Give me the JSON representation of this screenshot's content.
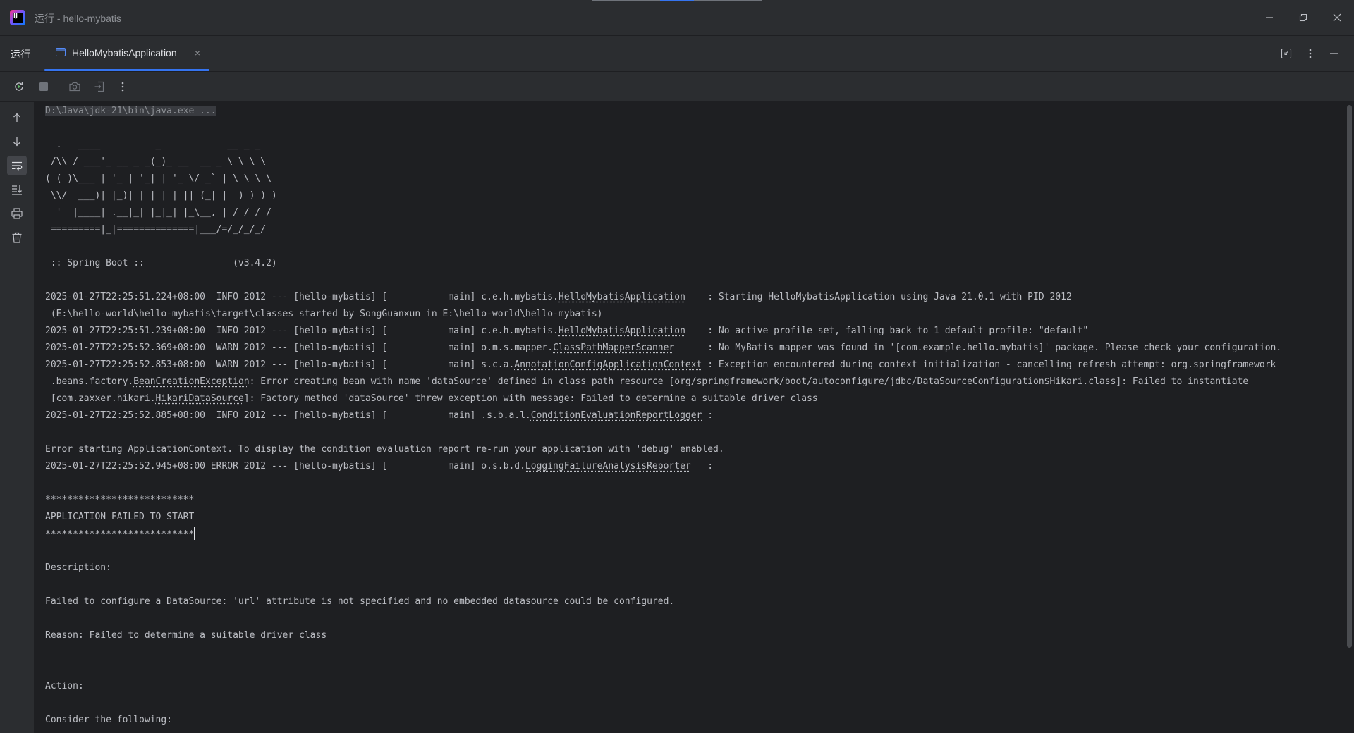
{
  "window": {
    "title": "运行 - hello-mybatis",
    "logo_text": "IJ",
    "icons": [
      "minimize-icon",
      "restore-icon",
      "close-icon"
    ]
  },
  "tool_window": {
    "label": "运行",
    "tab": {
      "label": "HelloMybatisApplication",
      "close": "×",
      "active": true
    }
  },
  "toolbar": {
    "icons": [
      "rerun-icon",
      "stop-icon",
      "camera-icon",
      "export-icon",
      "more-vertical-icon"
    ]
  },
  "left_rail": {
    "icons": [
      "arrow-up-icon",
      "arrow-down-icon",
      "soft-wrap-icon",
      "scroll-to-end-icon",
      "print-icon",
      "trash-icon"
    ],
    "active": "soft-wrap-icon"
  },
  "console": {
    "command": "D:\\Java\\jdk-21\\bin\\java.exe ...",
    "banner": [
      "  .   ____          _            __ _ _",
      " /\\\\ / ___'_ __ _ _(_)_ __  __ _ \\ \\ \\ \\",
      "( ( )\\___ | '_ | '_| | '_ \\/ _` | \\ \\ \\ \\",
      " \\\\/  ___)| |_)| | | | | || (_| |  ) ) ) )",
      "  '  |____| .__|_| |_|_| |_\\__, | / / / /",
      " =========|_|==============|___/=/_/_/_/"
    ],
    "spring_boot": " :: Spring Boot ::                (v3.4.2)",
    "log1": {
      "pre": "2025-01-27T22:25:51.224+08:00  INFO 2012 --- [hello-mybatis] [           main] c.e.h.mybatis.",
      "link": "HelloMybatisApplication",
      "post": "    : Starting HelloMybatisApplication using Java 21.0.1 with PID 2012"
    },
    "log1_cont": " (E:\\hello-world\\hello-mybatis\\target\\classes started by SongGuanxun in E:\\hello-world\\hello-mybatis)",
    "log2": {
      "pre": "2025-01-27T22:25:51.239+08:00  INFO 2012 --- [hello-mybatis] [           main] c.e.h.mybatis.",
      "link": "HelloMybatisApplication",
      "post": "    : No active profile set, falling back to 1 default profile: \"default\""
    },
    "log3": {
      "pre": "2025-01-27T22:25:52.369+08:00  WARN 2012 --- [hello-mybatis] [           main] o.m.s.mapper.",
      "link": "ClassPathMapperScanner",
      "post": "      : No MyBatis mapper was found in '[com.example.hello.mybatis]' package. Please check your configuration."
    },
    "log4": {
      "pre": "2025-01-27T22:25:52.853+08:00  WARN 2012 --- [hello-mybatis] [           main] s.c.a.",
      "link": "AnnotationConfigApplicationContext",
      "post": " : Exception encountered during context initialization - cancelling refresh attempt: org.springframework"
    },
    "log4_cont1": {
      "pre": " .beans.factory.",
      "link": "BeanCreationException",
      "post": ": Error creating bean with name 'dataSource' defined in class path resource [org/springframework/boot/autoconfigure/jdbc/DataSourceConfiguration$Hikari.class]: Failed to instantiate"
    },
    "log4_cont2": {
      "pre": " [com.zaxxer.hikari.",
      "link": "HikariDataSource",
      "post": "]: Factory method 'dataSource' threw exception with message: Failed to determine a suitable driver class"
    },
    "log5": {
      "pre": "2025-01-27T22:25:52.885+08:00  INFO 2012 --- [hello-mybatis] [           main] .s.b.a.l.",
      "link": "ConditionEvaluationReportLogger",
      "post": " :"
    },
    "error_ctx": "Error starting ApplicationContext. To display the condition evaluation report re-run your application with 'debug' enabled.",
    "log6": {
      "pre": "2025-01-27T22:25:52.945+08:00 ERROR 2012 --- [hello-mybatis] [           main] o.s.b.d.",
      "link": "LoggingFailureAnalysisReporter",
      "post": "   :"
    },
    "stars": "***************************",
    "failed": "APPLICATION FAILED TO START",
    "description_label": "Description:",
    "description": "Failed to configure a DataSource: 'url' attribute is not specified and no embedded datasource could be configured.",
    "reason": "Reason: Failed to determine a suitable driver class",
    "action_label": "Action:",
    "consider": "Consider the following:"
  }
}
